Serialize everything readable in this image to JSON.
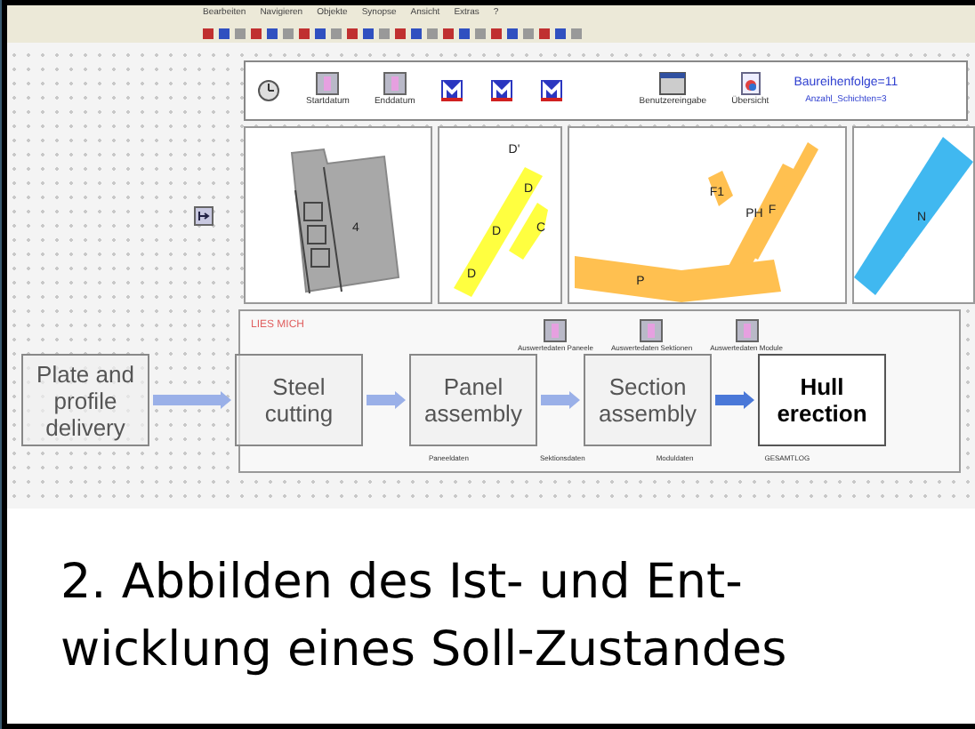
{
  "menu": [
    "Bearbeiten",
    "Navigieren",
    "Objekte",
    "Synopse",
    "Ansicht",
    "Extras",
    "?"
  ],
  "tool_buttons": [
    {
      "kind": "clock"
    },
    {
      "kind": "date",
      "label": "Startdatum"
    },
    {
      "kind": "date",
      "label": "Enddatum"
    },
    {
      "kind": "module"
    },
    {
      "kind": "module"
    },
    {
      "kind": "module"
    },
    {
      "kind": "window",
      "label": "Benutzereingabe"
    },
    {
      "kind": "doc",
      "label": "Übersicht"
    }
  ],
  "parameters": [
    "Baureihenfolge=11",
    "Anzahl_Schichten=3"
  ],
  "panels": [
    {
      "kind": "gray",
      "labels": [
        "4"
      ]
    },
    {
      "kind": "yellow",
      "labels": [
        "D'",
        "D",
        "D",
        "D",
        "C"
      ]
    },
    {
      "kind": "orange",
      "labels": [
        "F1",
        "PH",
        "F",
        "P"
      ]
    },
    {
      "kind": "blue",
      "labels": [
        "N"
      ]
    }
  ],
  "readme": "LIES MICH",
  "data_items": [
    "Auswertedaten Paneele",
    "Auswertedaten Sektionen",
    "Auswertedaten Module"
  ],
  "footer_labels": [
    "Paneeldaten",
    "Sektionsdaten",
    "Moduldaten",
    "GESAMTLOG"
  ],
  "process_steps": [
    {
      "label": "Plate and profile delivery",
      "highlighted": false
    },
    {
      "label": "Steel cutting",
      "highlighted": false
    },
    {
      "label": "Panel assembly",
      "highlighted": false
    },
    {
      "label": "Section assembly",
      "highlighted": false
    },
    {
      "label": "Hull erection",
      "highlighted": true
    }
  ],
  "caption": [
    "2. Abbilden des Ist- und Ent-",
    "wicklung eines Soll-Zustandes"
  ]
}
